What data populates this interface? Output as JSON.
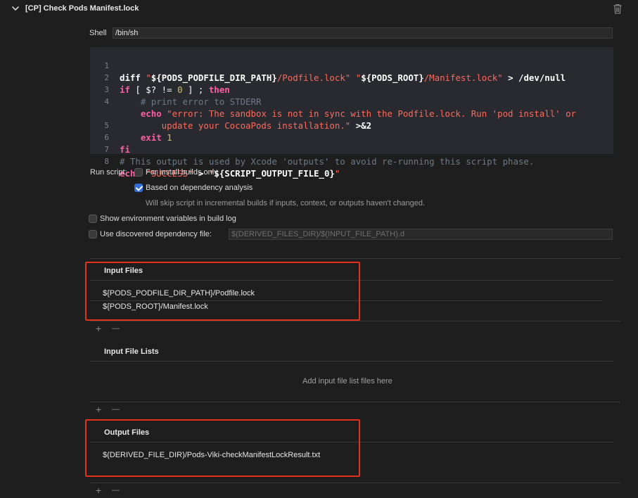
{
  "phase": {
    "title": "[CP] Check Pods Manifest.lock",
    "chevron_icon": "chevron-down-icon",
    "trash_icon": "trash-icon"
  },
  "shell": {
    "label": "Shell",
    "value": "/bin/sh"
  },
  "script": {
    "line_numbers": [
      "1",
      "2",
      "3",
      "4",
      "",
      "5",
      "6",
      "7",
      "8"
    ]
  },
  "run_script": {
    "label": "Run script:",
    "install_builds_only": {
      "label": "For install builds only",
      "checked": false
    },
    "dependency_analysis": {
      "label": "Based on dependency analysis",
      "checked": true
    },
    "dependency_hint": "Will skip script in incremental builds if inputs, context, or outputs haven't changed."
  },
  "show_env_vars": {
    "label": "Show environment variables in build log",
    "checked": false
  },
  "discovered_dependency": {
    "label": "Use discovered dependency file:",
    "checked": false,
    "placeholder": "$(DERIVED_FILES_DIR)/$(INPUT_FILE_PATH).d"
  },
  "input_files": {
    "title": "Input Files",
    "files": [
      "${PODS_PODFILE_DIR_PATH}/Podfile.lock",
      "${PODS_ROOT}/Manifest.lock"
    ]
  },
  "input_file_lists": {
    "title": "Input File Lists",
    "empty_hint": "Add input file list files here"
  },
  "output_files": {
    "title": "Output Files",
    "files": [
      "$(DERIVED_FILE_DIR)/Pods-Viki-checkManifestLockResult.txt"
    ]
  },
  "controls": {
    "add": "+",
    "remove": "—"
  },
  "colors": {
    "background": "#1e1e1e",
    "editor_background": "#292a30",
    "keyword": "#fc5fa3",
    "string": "#fc6a5d",
    "comment": "#6c7986",
    "number": "#d0bf69",
    "checkbox_checked": "#2f6ed8",
    "highlight": "#e0321c"
  }
}
